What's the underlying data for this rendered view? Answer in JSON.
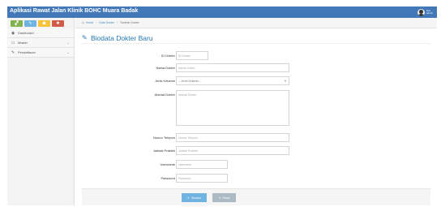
{
  "app": {
    "title": "Aplikasi Rawat Jalan Klinik BOHC Muara Badak",
    "user_greeting": "Hai,",
    "user_name": "admin"
  },
  "sidebar": {
    "shortcuts": [
      {
        "icon": "bar-chart-icon",
        "glyph": "▞",
        "color": "#81b34e"
      },
      {
        "icon": "pencil-icon",
        "glyph": "✎",
        "color": "#6fb3e0"
      },
      {
        "icon": "users-icon",
        "glyph": "☗",
        "color": "#f7c13a"
      },
      {
        "icon": "cogs-icon",
        "glyph": "✱",
        "color": "#d15b47"
      }
    ],
    "items": [
      {
        "label": "Dashboard",
        "icon": "dashboard-icon",
        "glyph": "◉",
        "has_caret": false
      },
      {
        "label": "Master",
        "icon": "desktop-icon",
        "glyph": "▭",
        "has_caret": true
      },
      {
        "label": "Pendaftaran",
        "icon": "edit-icon",
        "glyph": "✎",
        "has_caret": true
      }
    ]
  },
  "breadcrumb": {
    "home": "Home",
    "level1": "Data Dokter",
    "current": "Tambah Dokter"
  },
  "page": {
    "title": "Biodata Dokter Baru",
    "title_icon": "edit-icon"
  },
  "form": {
    "fields": [
      {
        "label": "ID Dokter",
        "placeholder": "ID Dokter",
        "type": "text"
      },
      {
        "label": "Nama Dokter",
        "placeholder": "Nama Dokter",
        "type": "text"
      },
      {
        "label": "Jenis Kelamin",
        "placeholder": "-- Jenis Kelamin --",
        "type": "select"
      },
      {
        "label": "Alamat Dokter",
        "placeholder": "Alamat Dokter",
        "type": "textarea"
      },
      {
        "label": "Nomor Telepon",
        "placeholder": "Nomor Telepon",
        "type": "text"
      },
      {
        "label": "Jadwal Praktek",
        "placeholder": "Jadwal Praktek",
        "type": "text"
      },
      {
        "label": "Username",
        "placeholder": "Username",
        "type": "text"
      },
      {
        "label": "Password",
        "placeholder": "Password",
        "type": "password"
      }
    ],
    "save_label": "Simpan",
    "reset_label": "Reset"
  },
  "colors": {
    "topbar": "#4277b8",
    "accent": "#2679b5",
    "save": "#6fb3e0",
    "reset": "#abbac3"
  }
}
